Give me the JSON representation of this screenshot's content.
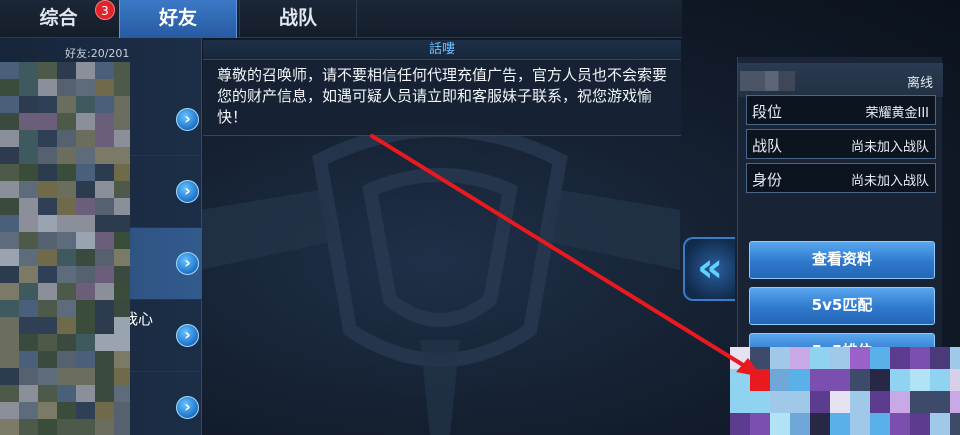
{
  "tabs": [
    {
      "label": "综合",
      "badge": "3",
      "active": false
    },
    {
      "label": "好友",
      "active": true
    },
    {
      "label": "战队",
      "active": false
    }
  ],
  "friends": {
    "count_label": "好友:20/201",
    "rows": [
      {
        "text": "。"
      },
      {
        "text": ""
      },
      {
        "text": ""
      },
      {
        "text": "以我心"
      },
      {
        "text": ""
      }
    ],
    "go_icon": "chevron-right-icon"
  },
  "chat": {
    "title": "話嘍",
    "notice": "尊敬的召唤师，请不要相信任何代理充值广告，官方人员也不会索要您的财产信息，如遇可疑人员请立即和客服妹子联系，祝您游戏愉快！"
  },
  "profile": {
    "status": "离线",
    "rows": [
      {
        "label": "段位",
        "value": "荣耀黄金III"
      },
      {
        "label": "战队",
        "value": "尚未加入战队"
      },
      {
        "label": "身份",
        "value": "尚未加入战队"
      }
    ],
    "buttons": [
      "查看资料",
      "5v5匹配",
      "5v5排位"
    ]
  },
  "collapse_icon": "double-chevron-left-icon",
  "colors": {
    "accent": "#3b79c7",
    "button": "#3f8ee0",
    "badge": "#e0242b",
    "annotation_arrow": "#e8191f",
    "title_text": "#6cc0ff"
  }
}
